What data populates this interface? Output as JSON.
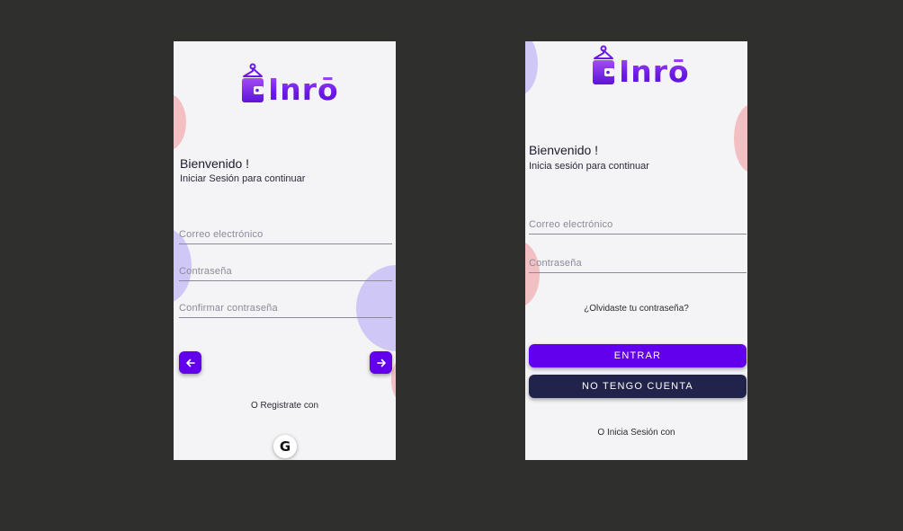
{
  "colors": {
    "primary": "#6200ee",
    "secondary": "#22234a",
    "background": "#2f2f2e"
  },
  "brand": {
    "name": "Inrō"
  },
  "register": {
    "title": "Bienvenido !",
    "subtitle": "Iniciar Sesión para continuar",
    "email_placeholder": "Correo electrónico",
    "password_placeholder": "Contraseña",
    "confirm_placeholder": "Confirmar contraseña",
    "back_icon": "arrow-left-icon",
    "next_icon": "arrow-right-icon",
    "social_caption": "O Registrate con",
    "google_label": "G"
  },
  "login": {
    "title": "Bienvenido !",
    "subtitle": "Inicia sesión para continuar",
    "email_placeholder": "Correo electrónico",
    "password_placeholder": "Contraseña",
    "forgot_label": "¿Olvidaste tu contraseña?",
    "enter_label": "ENTRAR",
    "no_account_label": "NO TENGO CUENTA",
    "social_caption": "O Inicia Sesión con"
  }
}
